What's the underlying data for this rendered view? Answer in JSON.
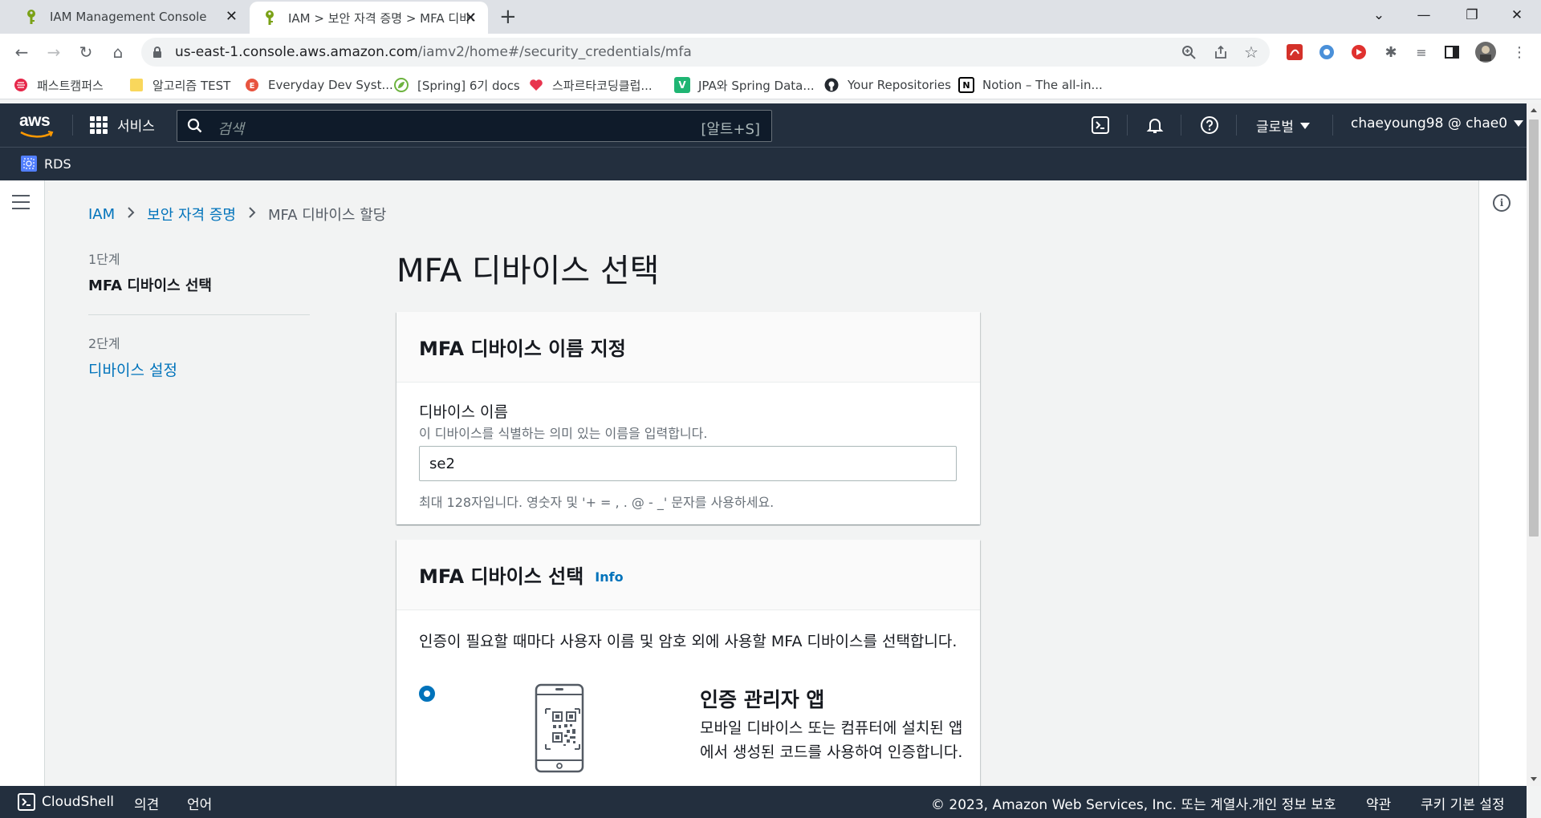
{
  "browser": {
    "tabs": [
      {
        "title": "IAM Management Console"
      },
      {
        "title": "IAM > 보안 자격 증명 > MFA 디바이스 할당"
      }
    ],
    "url_host": "us-east-1.console.aws.amazon.com",
    "url_path": "/iamv2/home#/security_credentials/mfa",
    "bookmarks": [
      {
        "label": "패스트캠퍼스",
        "color": "#e6274a"
      },
      {
        "label": "알고리즘 TEST",
        "color": "#f9d75c"
      },
      {
        "label": "Everyday Dev Syst...",
        "color": "#e8543f"
      },
      {
        "label": "[Spring] 6기 docs",
        "color": "#6db33f"
      },
      {
        "label": "스파르타코딩클럽...",
        "color": "#e8344e"
      },
      {
        "label": "JPA와 Spring Data...",
        "color": "#1fb573"
      },
      {
        "label": "Your Repositories",
        "color": "#24292f"
      },
      {
        "label": "Notion – The all-in...",
        "color": "#000000"
      }
    ]
  },
  "aws": {
    "logo": "aws",
    "services_label": "서비스",
    "search_placeholder": "검색",
    "search_shortcut": "[알트+S]",
    "region_label": "글로벌",
    "account_label": "chaeyoung98 @ chae0",
    "favorite_service": "RDS"
  },
  "breadcrumb": {
    "items": [
      "IAM",
      "보안 자격 증명",
      "MFA 디바이스 할당"
    ]
  },
  "steps": [
    {
      "label": "1단계",
      "name": "MFA 디바이스 선택"
    },
    {
      "label": "2단계",
      "name": "디바이스 설정"
    }
  ],
  "page": {
    "title": "MFA 디바이스 선택"
  },
  "name_card": {
    "title": "MFA 디바이스 이름 지정",
    "field_label": "디바이스 이름",
    "field_description": "이 디바이스를 식별하는 의미 있는 이름을 입력합니다.",
    "field_value": "se2",
    "field_hint": "최대 128자입니다. 영숫자 및 '+ = , . @ - _' 문자를 사용하세요."
  },
  "select_card": {
    "title": "MFA 디바이스 선택",
    "info_link": "Info",
    "description": "인증이 필요할 때마다 사용자 이름 및 암호 외에 사용할 MFA 디바이스를 선택합니다.",
    "options": [
      {
        "title": "인증 관리자 앱",
        "description": "모바일 디바이스 또는 컴퓨터에 설치된 앱에서 생성된 코드를 사용하여 인증합니다.",
        "selected": true
      }
    ]
  },
  "footer": {
    "cloudshell": "CloudShell",
    "feedback": "의견",
    "language": "언어",
    "copyright": "© 2023, Amazon Web Services, Inc. 또는 계열사.",
    "privacy": "개인 정보 보호",
    "terms": "약관",
    "cookies": "쿠키 기본 설정"
  },
  "colors": {
    "aws_nav": "#232f3e",
    "link": "#0073bb",
    "page_bg": "#f2f3f3"
  }
}
